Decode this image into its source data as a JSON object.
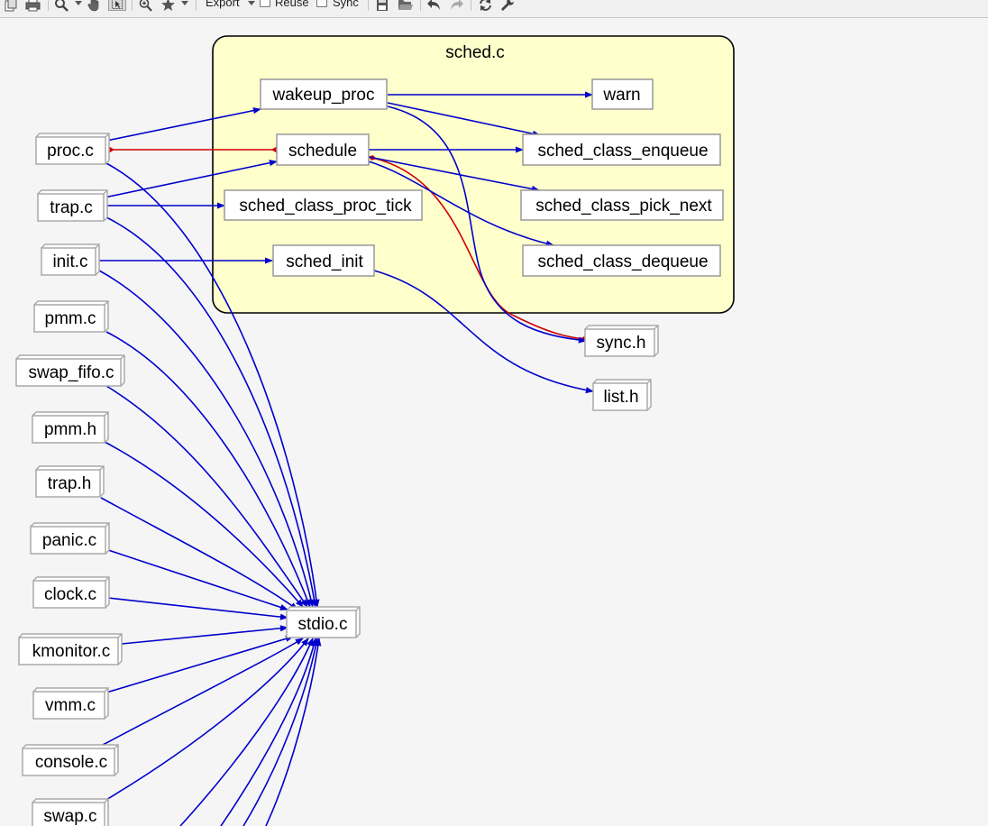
{
  "toolbar": {
    "export_label": "Export",
    "reuse_label": "Reuse",
    "sync_label": "Sync",
    "reuse_checked": false,
    "sync_checked": false
  },
  "graph": {
    "cluster_label": "sched.c",
    "edge_colors": {
      "call": "#0000cc",
      "include": "#cc0000"
    },
    "nodes": {
      "wakeup_proc": "wakeup_proc",
      "warn": "warn",
      "schedule": "schedule",
      "sched_class_enqueue": "sched_class_enqueue",
      "sched_class_proc_tick": "sched_class_proc_tick",
      "sched_class_pick_next": "sched_class_pick_next",
      "sched_init": "sched_init",
      "sched_class_dequeue": "sched_class_dequeue",
      "proc_c": "proc.c",
      "trap_c": "trap.c",
      "init_c": "init.c",
      "pmm_c": "pmm.c",
      "swap_fifo_c": "swap_fifo.c",
      "pmm_h": "pmm.h",
      "trap_h": "trap.h",
      "panic_c": "panic.c",
      "clock_c": "clock.c",
      "kmonitor_c": "kmonitor.c",
      "vmm_c": "vmm.c",
      "console_c": "console.c",
      "swap_c": "swap.c",
      "sync_h": "sync.h",
      "list_h": "list.h",
      "stdio_c": "stdio.c"
    }
  }
}
